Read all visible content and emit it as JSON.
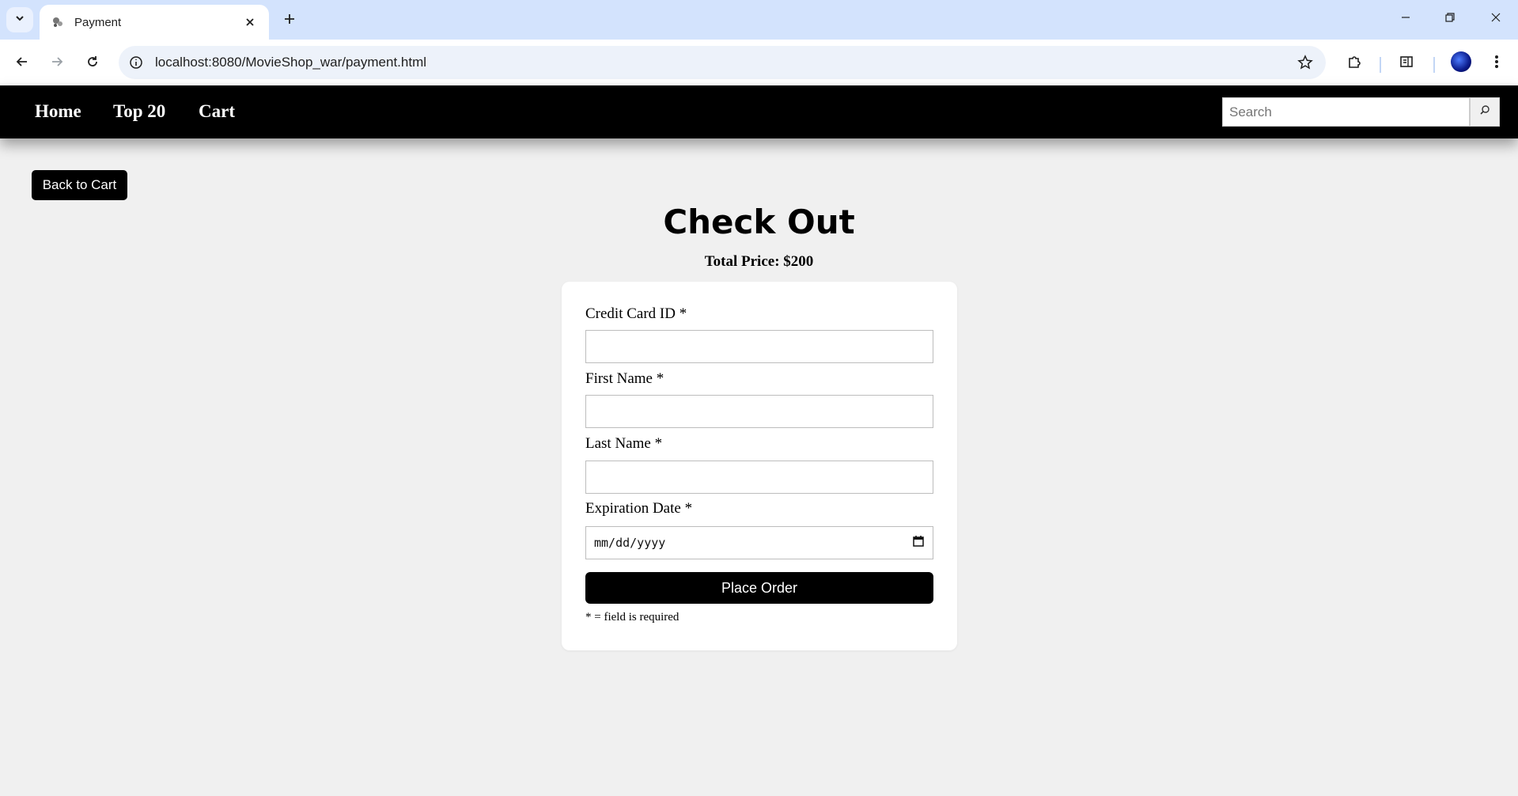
{
  "browser": {
    "tab_title": "Payment",
    "url": "localhost:8080/MovieShop_war/payment.html"
  },
  "navbar": {
    "links": [
      "Home",
      "Top 20",
      "Cart"
    ],
    "search_placeholder": "Search"
  },
  "page": {
    "back_button": "Back to Cart",
    "title": "Check Out",
    "total_price": "Total Price: $200"
  },
  "form": {
    "fields": [
      {
        "label": "Credit Card ID *",
        "value": ""
      },
      {
        "label": "First Name *",
        "value": ""
      },
      {
        "label": "Last Name *",
        "value": ""
      },
      {
        "label": "Expiration Date *",
        "value": "mm/dd/yyyy"
      }
    ],
    "submit_label": "Place Order",
    "required_note": "* = field is required"
  },
  "icons": {
    "tab_search": "chevron-down-icon",
    "favicon": "tab-favicon-icon",
    "tab_close": "close-icon",
    "new_tab": "plus-icon",
    "back": "arrow-left-icon",
    "forward": "arrow-right-icon",
    "reload": "reload-icon",
    "site_info": "info-icon",
    "bookmark": "star-icon",
    "extensions": "puzzle-icon",
    "reading_list": "side-panel-icon",
    "menu": "more-vertical-icon",
    "search": "search-icon",
    "calendar": "calendar-icon"
  },
  "colors": {
    "navbar_bg": "#000000",
    "page_bg": "#f0f0f0",
    "tabstrip_bg": "#d3e3fd",
    "button_bg": "#000000"
  }
}
